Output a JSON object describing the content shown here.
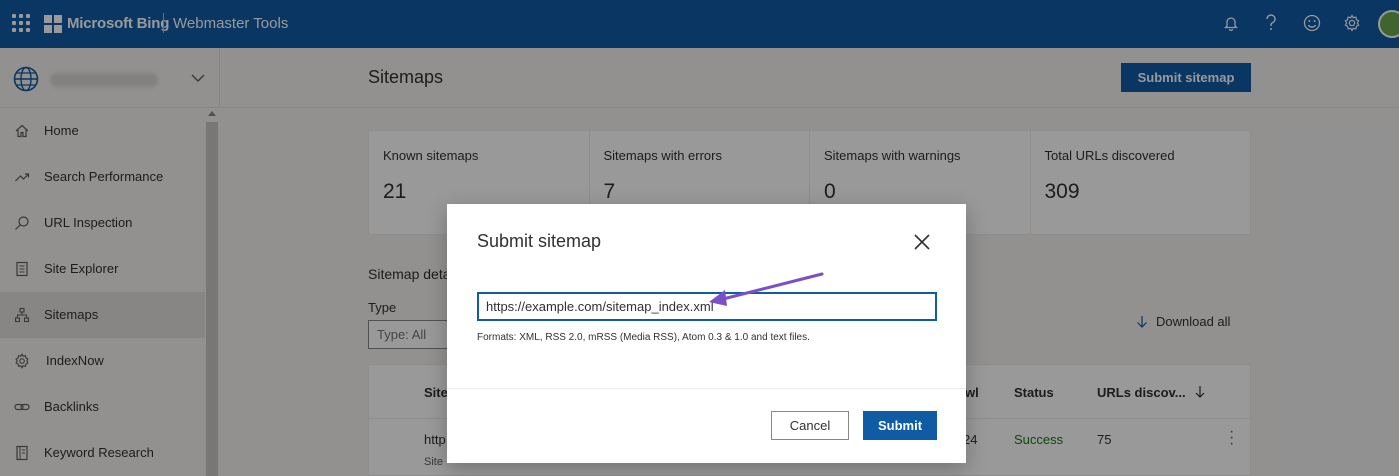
{
  "topbar": {
    "brand": "Microsoft Bing",
    "product": "Webmaster Tools",
    "icons": [
      "bell-icon",
      "help-icon",
      "smiley-icon",
      "gear-icon",
      "avatar"
    ]
  },
  "sidebar": {
    "items": [
      {
        "label": "Home",
        "icon": "home-icon"
      },
      {
        "label": "Search Performance",
        "icon": "trend-icon"
      },
      {
        "label": "URL Inspection",
        "icon": "search-icon"
      },
      {
        "label": "Site Explorer",
        "icon": "document-icon"
      },
      {
        "label": "Sitemaps",
        "icon": "sitemap-icon",
        "active": true
      },
      {
        "label": "IndexNow",
        "icon": "gear-icon"
      },
      {
        "label": "Backlinks",
        "icon": "link-icon"
      },
      {
        "label": "Keyword Research",
        "icon": "notebook-icon"
      }
    ]
  },
  "main": {
    "title": "Sitemaps",
    "submit_button": "Submit sitemap",
    "stats": [
      {
        "label": "Known sitemaps",
        "value": "21"
      },
      {
        "label": "Sitemaps with errors",
        "value": "7"
      },
      {
        "label": "Sitemaps with warnings",
        "value": "0"
      },
      {
        "label": "Total URLs discovered",
        "value": "309"
      }
    ],
    "details_title": "Sitemap deta",
    "type_label": "Type",
    "type_placeholder": "Type: All",
    "download_all": "Download all",
    "table": {
      "col_sitemap": "Site",
      "col_crawl": "wl",
      "col_status": "Status",
      "col_urls": "URLs discov...",
      "row": {
        "sitemap": "http",
        "sitemap_sub": "Site",
        "crawl": "24",
        "status": "Success",
        "urls": "75"
      }
    }
  },
  "modal": {
    "title": "Submit sitemap",
    "input_value": "https://example.com/sitemap_index.xml",
    "hint": "Formats: XML, RSS 2.0, mRSS (Media RSS), Atom 0.3 & 1.0 and text files.",
    "cancel": "Cancel",
    "submit": "Submit"
  },
  "colors": {
    "brand": "#0f5ba4",
    "success": "#107c10",
    "annotation_arrow": "#7b4fc7"
  }
}
